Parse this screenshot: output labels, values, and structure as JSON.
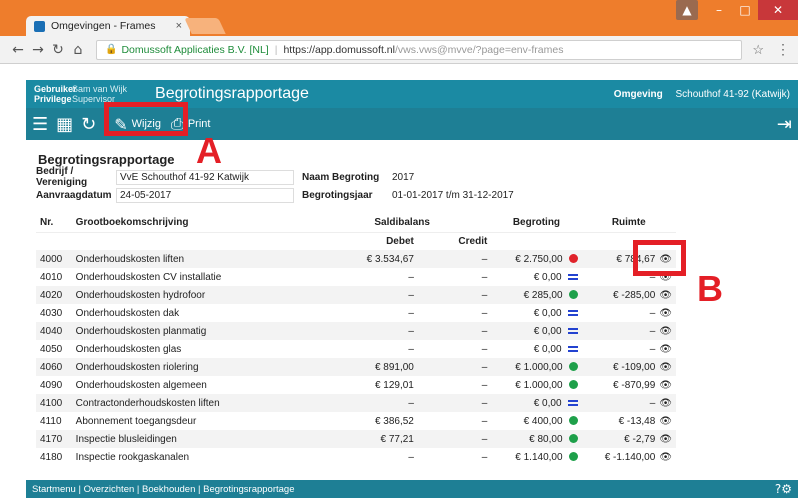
{
  "browser": {
    "tab_title": "Omgevingen - Frames",
    "tab_close": "×",
    "site_identity": "Domussoft Applicaties B.V. [NL]",
    "url_main": "https://app.domussoft.nl",
    "url_rest": "/vws.vws@mvve/?page=env-frames",
    "controls": {
      "user": "▲",
      "minimize": "–",
      "maximize": "□",
      "close": "✕"
    }
  },
  "app_header": {
    "user_label": "Gebruiker",
    "user_value": "Sam van Wijk",
    "privilege_label": "Privilege",
    "privilege_value": "Supervisor",
    "title": "Begrotingsrapportage",
    "env_label": "Omgeving",
    "env_value": "Schouthof 41-92 (Katwijk)"
  },
  "toolbar": {
    "edit_label": "Wijzig",
    "print_label": "Print"
  },
  "annotations": {
    "a": "A",
    "b": "B"
  },
  "page": {
    "heading": "Begrotingsrapportage",
    "company_label": "Bedrijf / Vereniging",
    "company_value": "VvE Schouthof 41-92 Katwijk",
    "budget_name_label": "Naam Begroting",
    "budget_name_value": "2017",
    "request_date_label": "Aanvraagdatum",
    "request_date_value": "24-05-2017",
    "budget_year_label": "Begrotingsjaar",
    "budget_year_value": "01-01-2017 t/m 31-12-2017"
  },
  "table": {
    "headers": {
      "nr": "Nr.",
      "desc": "Grootboekomschrijving",
      "saldi": "Saldibalans",
      "budget": "Begroting",
      "space": "Ruimte",
      "debet": "Debet",
      "credit": "Credit"
    },
    "rows": [
      {
        "nr": "4000",
        "desc": "Onderhoudskosten liften",
        "debet": "€ 3.534,67",
        "credit": "–",
        "budget": "€ 2.750,00",
        "space": "€ 784,67"
      },
      {
        "nr": "4010",
        "desc": "Onderhoudskosten CV installatie",
        "debet": "–",
        "credit": "–",
        "budget": "€ 0,00",
        "space": "–"
      },
      {
        "nr": "4020",
        "desc": "Onderhoudskosten hydrofoor",
        "debet": "–",
        "credit": "–",
        "budget": "€ 285,00",
        "space": "€ -285,00"
      },
      {
        "nr": "4030",
        "desc": "Onderhoudskosten dak",
        "debet": "–",
        "credit": "–",
        "budget": "€ 0,00",
        "space": "–"
      },
      {
        "nr": "4040",
        "desc": "Onderhoudskosten planmatig",
        "debet": "–",
        "credit": "–",
        "budget": "€ 0,00",
        "space": "–"
      },
      {
        "nr": "4050",
        "desc": "Onderhoudskosten glas",
        "debet": "–",
        "credit": "–",
        "budget": "€ 0,00",
        "space": "–"
      },
      {
        "nr": "4060",
        "desc": "Onderhoudskosten riolering",
        "debet": "€ 891,00",
        "credit": "–",
        "budget": "€ 1.000,00",
        "space": "€ -109,00"
      },
      {
        "nr": "4090",
        "desc": "Onderhoudskosten algemeen",
        "debet": "€ 129,01",
        "credit": "–",
        "budget": "€ 1.000,00",
        "space": "€ -870,99"
      },
      {
        "nr": "4100",
        "desc": "Contractonderhoudskosten liften",
        "debet": "–",
        "credit": "–",
        "budget": "€ 0,00",
        "space": "–"
      },
      {
        "nr": "4110",
        "desc": "Abonnement toegangsdeur",
        "debet": "€ 386,52",
        "credit": "–",
        "budget": "€ 400,00",
        "space": "€ -13,48"
      },
      {
        "nr": "4170",
        "desc": "Inspectie blusleidingen",
        "debet": "€ 77,21",
        "credit": "–",
        "budget": "€ 80,00",
        "space": "€ -2,79"
      },
      {
        "nr": "4180",
        "desc": "Inspectie rookgaskanalen",
        "debet": "–",
        "credit": "–",
        "budget": "€ 1.140,00",
        "space": "€ -1.140,00"
      }
    ],
    "status": [
      "red",
      "eq",
      "green",
      "eq",
      "eq",
      "eq",
      "green",
      "green",
      "eq",
      "green",
      "green",
      "green"
    ]
  },
  "footer": {
    "breadcrumb": "Startmenu | Overzichten | Boekhouden | Begrotingsrapportage"
  },
  "colors": {
    "header": "#1b8aa3",
    "toolbar": "#1e7f95",
    "chrome": "#ee7d2c",
    "annotation": "#e41f26"
  }
}
